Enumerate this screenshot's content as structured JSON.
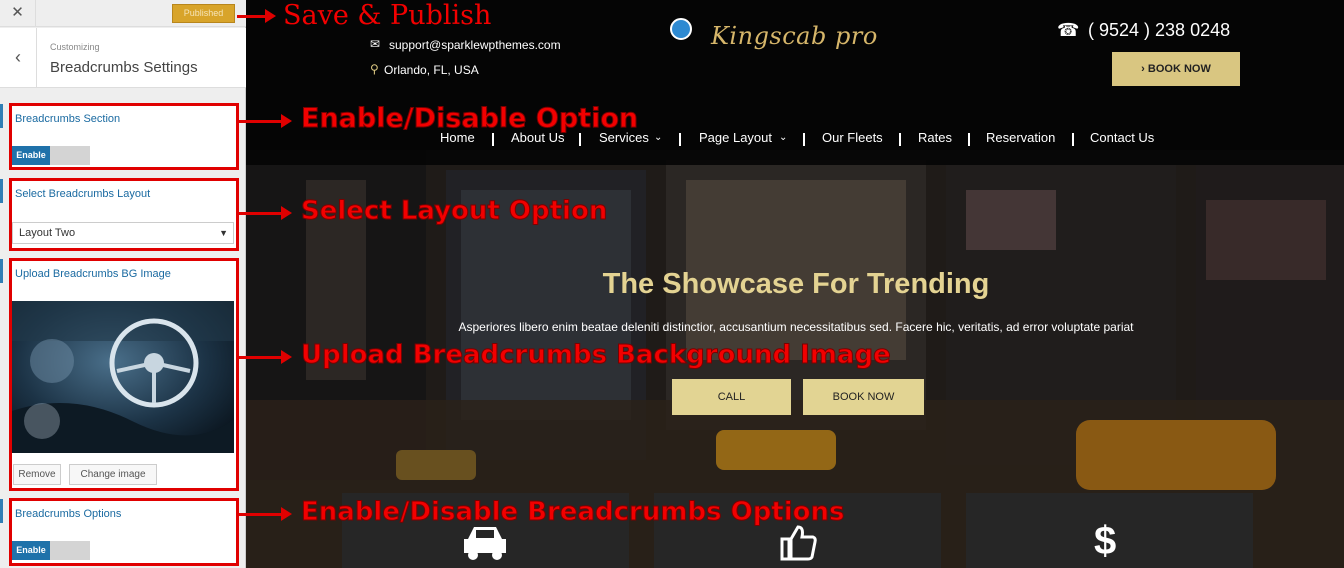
{
  "sidebar": {
    "close_icon": "close-icon",
    "publish_label": "Published",
    "back_icon": "chevron-left-icon",
    "subtitle": "Customizing",
    "title": "Breadcrumbs Settings",
    "controls": {
      "section": {
        "label": "Breadcrumbs Section",
        "toggle": "Enable"
      },
      "layout": {
        "label": "Select Breadcrumbs Layout",
        "value": "Layout Two"
      },
      "bg_image": {
        "label": "Upload Breadcrumbs BG Image",
        "remove_label": "Remove",
        "change_label": "Change image"
      },
      "options": {
        "label": "Breadcrumbs Options",
        "toggle": "Enable"
      }
    }
  },
  "site": {
    "email": "support@sparklewpthemes.com",
    "location": "Orlando, FL, USA",
    "logo": "Kingscab pro",
    "phone": "( 9524 ) 238 0248",
    "book_top": "BOOK NOW",
    "nav": [
      "Home",
      "About Us",
      "Services",
      "Page Layout",
      "Our Fleets",
      "Rates",
      "Reservation",
      "Contact Us"
    ],
    "hero_title": "The Showcase For Trending",
    "hero_text": "Asperiores libero enim beatae deleniti distinctior, accusantium necessitatibus sed. Facere hic, veritatis, ad error voluptate pariat",
    "hero_buttons": [
      "CALL",
      "BOOK NOW"
    ],
    "features": [
      "car-icon",
      "thumbs-up-icon",
      "dollar-icon"
    ]
  },
  "annotations": {
    "save": "Save & Publish",
    "enable": "Enable/Disable Option",
    "layout": "Select Layout Option",
    "upload": "Upload Breadcrumbs Background Image",
    "options": "Enable/Disable Breadcrumbs Options"
  },
  "colors": {
    "accent": "#2f7eb5",
    "publish": "#d8a42a",
    "gold": "#d9c681",
    "annotation": "#e00000"
  }
}
